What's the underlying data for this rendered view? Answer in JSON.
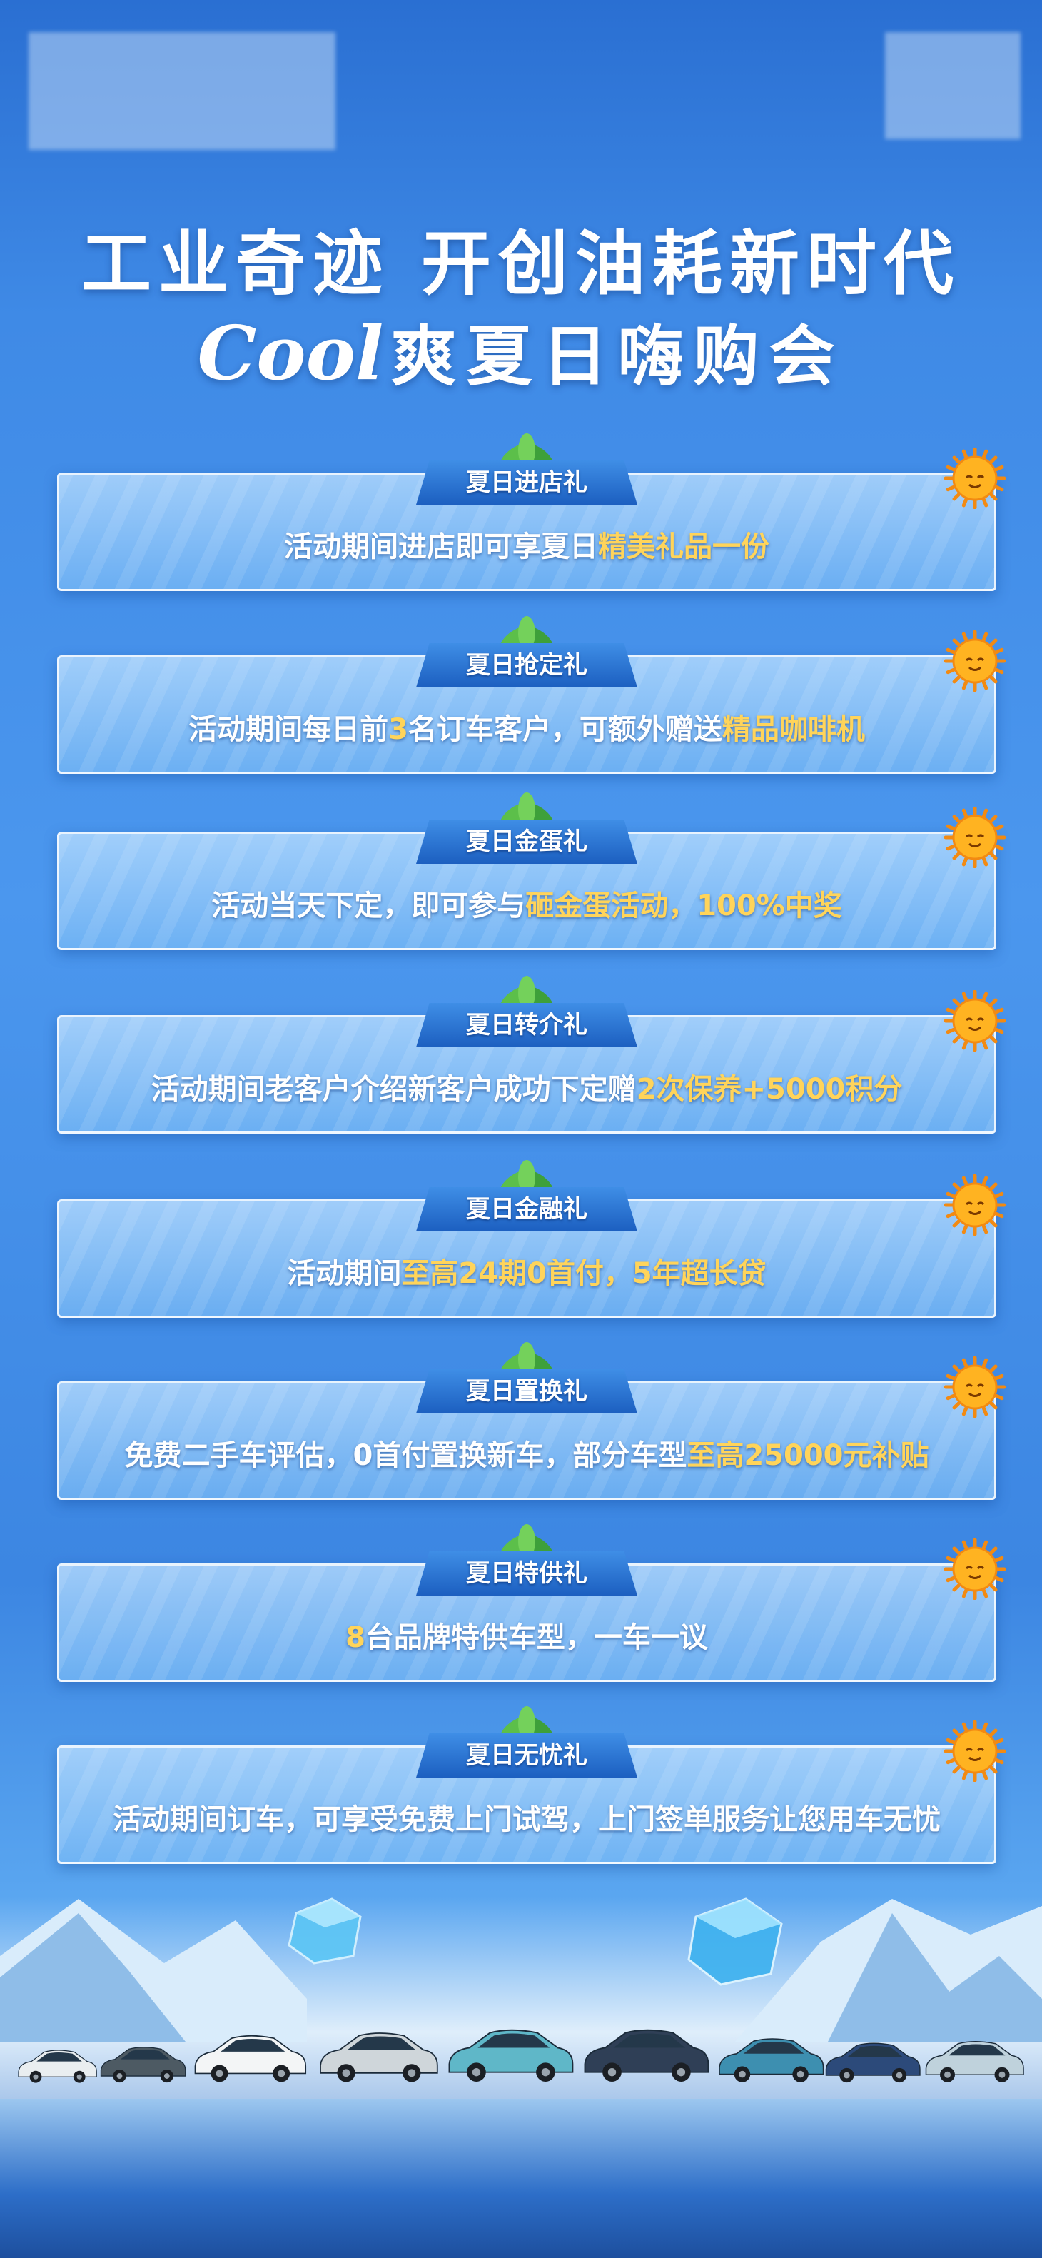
{
  "title_line1": "工业奇迹  开创油耗新时代",
  "title_cool": "Cool",
  "title_line2": "爽夏日嗨购会",
  "gifts": [
    {
      "name": "夏日进店礼",
      "parts": [
        {
          "t": "活动期间进店即可享夏日",
          "h": false
        },
        {
          "t": "精美礼品一份",
          "h": true
        }
      ]
    },
    {
      "name": "夏日抢定礼",
      "parts": [
        {
          "t": "活动期间每日前",
          "h": false
        },
        {
          "t": "3",
          "h": true
        },
        {
          "t": "名订车客户，可额外赠送",
          "h": false
        },
        {
          "t": "精品咖啡机",
          "h": true
        }
      ]
    },
    {
      "name": "夏日金蛋礼",
      "parts": [
        {
          "t": "活动当天下定，即可参与",
          "h": false
        },
        {
          "t": "砸金蛋活动，100%中奖",
          "h": true
        }
      ]
    },
    {
      "name": "夏日转介礼",
      "parts": [
        {
          "t": "活动期间老客户介绍新客户成功下定赠",
          "h": false
        },
        {
          "t": "2次保养+5000积分",
          "h": true
        }
      ]
    },
    {
      "name": "夏日金融礼",
      "parts": [
        {
          "t": "活动期间",
          "h": false
        },
        {
          "t": "至高24期0首付，5年超长贷",
          "h": true
        }
      ]
    },
    {
      "name": "夏日置换礼",
      "parts": [
        {
          "t": "免费二手车评估，0首付置换新车，部分车型",
          "h": false
        },
        {
          "t": "至高25000元补贴",
          "h": true
        }
      ]
    },
    {
      "name": "夏日特供礼",
      "parts": [
        {
          "t": "8",
          "h": true
        },
        {
          "t": "台品牌特供车型，一车一议",
          "h": false
        }
      ]
    },
    {
      "name": "夏日无忧礼",
      "parts": [
        {
          "t": "活动期间订车，可享受免费上门试驾，上门签单服务让您用车无忧",
          "h": false
        }
      ]
    }
  ],
  "icons": {
    "sun": "sun-icon",
    "leaf": "leaf-icon",
    "car": "car-icon",
    "ice": "ice-cube-icon"
  },
  "colors": {
    "highlight": "#ffd45a",
    "tab": "#1c5fc0",
    "background": "#3f8ae6"
  }
}
